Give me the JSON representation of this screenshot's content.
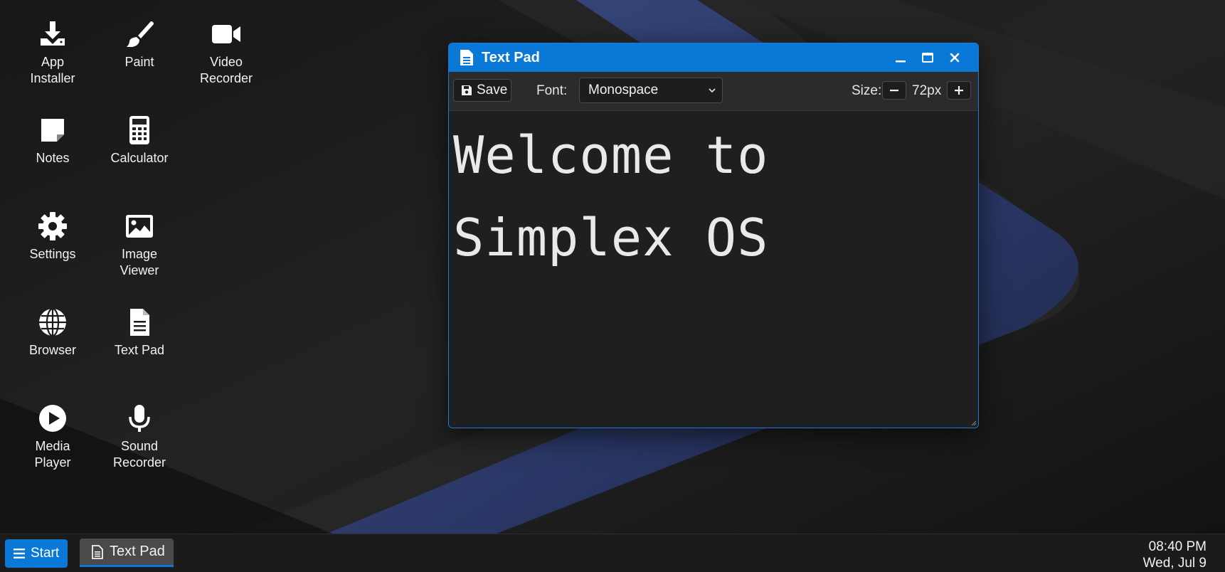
{
  "desktop": {
    "icons": [
      {
        "label": "App\nInstaller",
        "icon": "download-icon"
      },
      {
        "label": "Paint",
        "icon": "paintbrush-icon"
      },
      {
        "label": "Video\nRecorder",
        "icon": "video-camera-icon"
      },
      {
        "label": "Notes",
        "icon": "sticky-note-icon"
      },
      {
        "label": "Calculator",
        "icon": "calculator-icon"
      },
      {
        "label": "Settings",
        "icon": "gear-icon"
      },
      {
        "label": "Image\nViewer",
        "icon": "image-icon"
      },
      {
        "label": "Browser",
        "icon": "globe-icon"
      },
      {
        "label": "Text Pad",
        "icon": "document-icon"
      },
      {
        "label": "Media\nPlayer",
        "icon": "play-circle-icon"
      },
      {
        "label": "Sound\nRecorder",
        "icon": "microphone-icon"
      }
    ]
  },
  "window": {
    "title": "Text Pad",
    "toolbar": {
      "save_label": "Save",
      "font_label": "Font:",
      "font_value": "Monospace",
      "size_label": "Size:",
      "size_value": "72px"
    },
    "editor_text": "Welcome to\nSimplex OS"
  },
  "taskbar": {
    "start_label": "Start",
    "task_label": "Text Pad",
    "time": "08:40 PM",
    "date": "Wed, Jul 9"
  },
  "colors": {
    "accent": "#0a78d7",
    "window_bg": "#1f1f1f",
    "toolbar_bg": "#2b2b2b",
    "taskbar_bg": "#1b1b1b",
    "wallpaper_stripe": "#2e3a63"
  }
}
